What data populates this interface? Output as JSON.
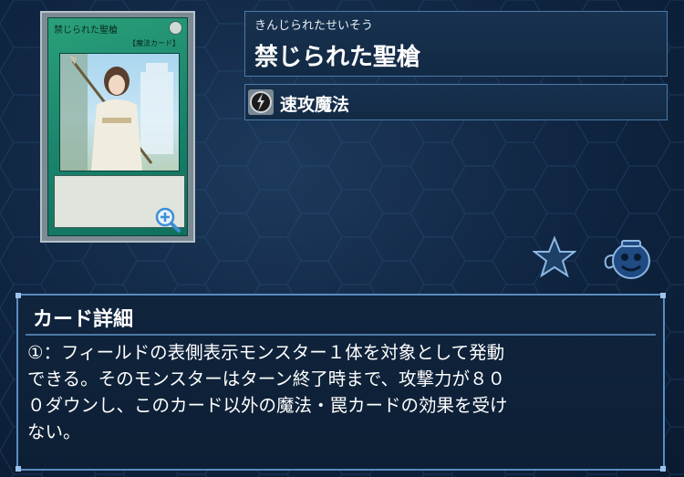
{
  "card": {
    "art_name": "禁じられた聖槍",
    "art_type": "【魔法カード】",
    "furigana": "きんじられたせいそう",
    "title": "禁じられた聖槍",
    "type_label": "速攻魔法"
  },
  "detail": {
    "heading": "カード詳細",
    "text": "①：フィールドの表側表示モンスター１体を対象として発動\nできる。そのモンスターはターン終了時まで、攻撃力が８０\n０ダウンし、このカード以外の魔法・罠カードの効果を受け\nない。"
  },
  "icons": {
    "zoom": "zoom-icon",
    "spell": "quick-play-spell-icon",
    "favorite": "star-icon",
    "deck": "pot-icon"
  },
  "colors": {
    "panel_border": "#4a7aa8",
    "spell_card_green": "#1a8a6c",
    "background": "#0f2440"
  }
}
